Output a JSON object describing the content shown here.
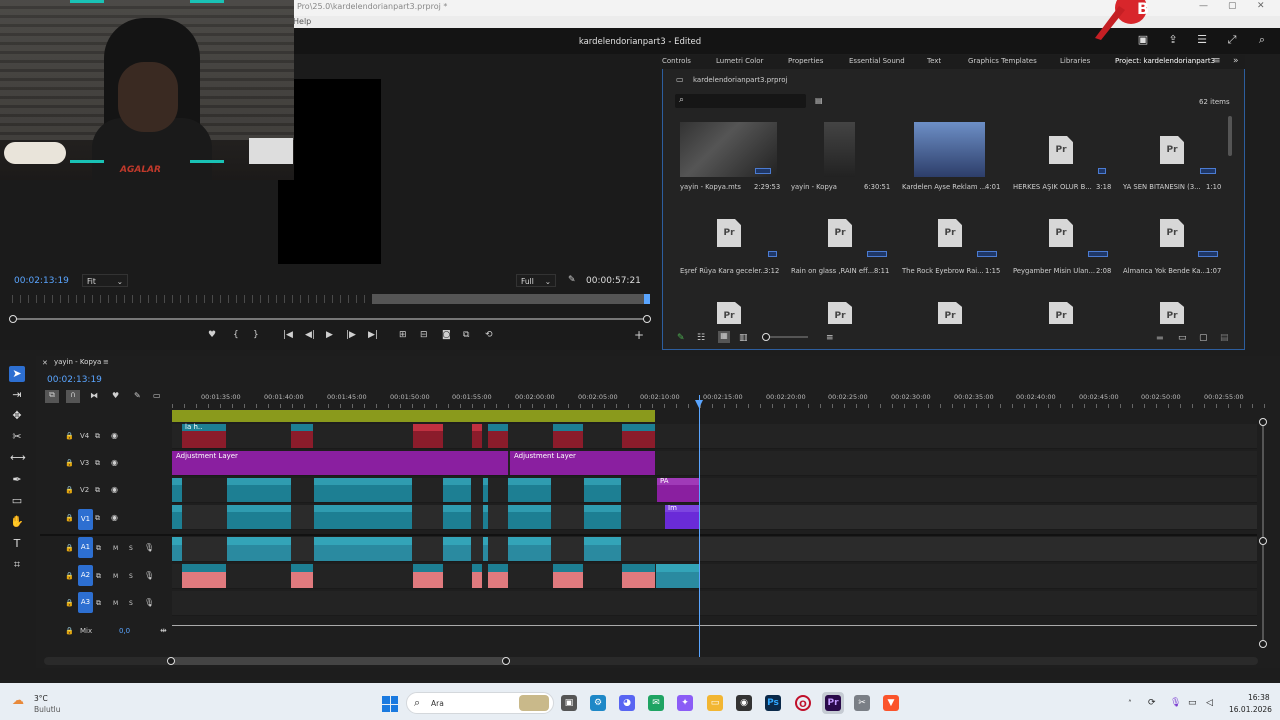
{
  "window": {
    "path": "Pro\\25.0\\kardelendorianpart3.prproj *",
    "menu_help": "Help",
    "app_title": "kardelendorianpart3 - Edited"
  },
  "overlay": {
    "logo_text": "AGALAR"
  },
  "program_monitor": {
    "timecode_left": "00:02:13:19",
    "fit_select": "Fit",
    "quality_select": "Full",
    "timecode_right": "00:00:57:21"
  },
  "project_panel": {
    "tabs": [
      "Controls",
      "Lumetri Color",
      "Properties",
      "Essential Sound",
      "Text",
      "Graphics Templates",
      "Libraries",
      "Project: kardelendorianpart3"
    ],
    "file_name": "kardelendorianpart3.prproj",
    "item_count": "62 items",
    "items": [
      {
        "name": "yayin - Kopya.mts",
        "duration": "2:29:53"
      },
      {
        "name": "yayin - Kopya",
        "duration": "6:30:51"
      },
      {
        "name": "Kardelen Ayse Reklam ...",
        "duration": "4:01"
      },
      {
        "name": "HERKES AŞIK OLUR B...",
        "duration": "3:18"
      },
      {
        "name": "YA SEN BITANESIN (3...",
        "duration": "1:10"
      },
      {
        "name": "Eşref Rüya Kara geceler...",
        "duration": "3:12"
      },
      {
        "name": "Rain on glass ,RAIN eff...",
        "duration": "8:11"
      },
      {
        "name": "The Rock Eyebrow Rai...",
        "duration": "1:15"
      },
      {
        "name": "Peygamber Misin Ulan...",
        "duration": "2:08"
      },
      {
        "name": "Almanca Yok Bende Ka...",
        "duration": "1:07"
      }
    ]
  },
  "timeline": {
    "sequence_name": "yayin - Kopya",
    "timecode": "00:02:13:19",
    "ruler_ticks": [
      "00:01:35:00",
      "00:01:40:00",
      "00:01:45:00",
      "00:01:50:00",
      "00:01:55:00",
      "00:02:00:00",
      "00:02:05:00",
      "00:02:10:00",
      "00:02:15:00",
      "00:02:20:00",
      "00:02:25:00",
      "00:02:30:00",
      "00:02:35:00",
      "00:02:40:00",
      "00:02:45:00",
      "00:02:50:00",
      "00:02:55:00"
    ],
    "video_tracks": [
      "V4",
      "V3",
      "V2",
      "V1"
    ],
    "audio_tracks": [
      "A1",
      "A2",
      "A3"
    ],
    "mix_label": "Mix",
    "mix_value": "0,0",
    "adjustment_label": "Adjustment Layer",
    "clip_labels": {
      "pa": "PA",
      "im": "Im",
      "la": "la h.."
    }
  },
  "taskbar": {
    "weather_temp": "3°C",
    "weather_desc": "Bulutlu",
    "search_placeholder": "Ara",
    "time": "16:38",
    "date": "16.01.2026"
  },
  "colors": {
    "accent": "#2d6fd1",
    "clip_teal": "#1d7f93",
    "adjustment": "#8a1fa0",
    "playhead": "#5aa5ff"
  }
}
